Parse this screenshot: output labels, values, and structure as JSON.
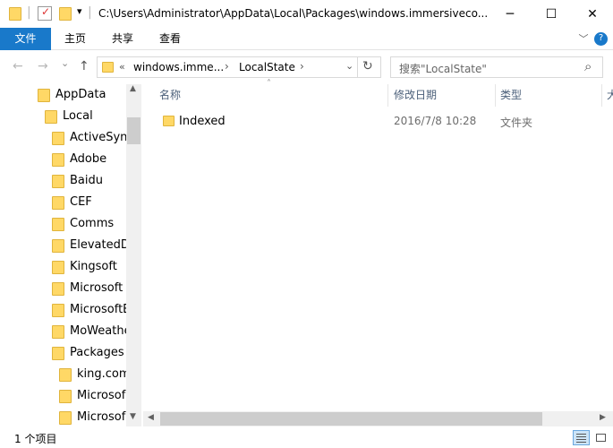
{
  "window": {
    "title": "C:\\Users\\Administrator\\AppData\\Local\\Packages\\windows.immersiveco...",
    "minimize": "─",
    "maximize": "☐",
    "close": "✕"
  },
  "ribbon": {
    "tabs": [
      "文件",
      "主页",
      "共享",
      "查看"
    ],
    "expand_icon": "﹀",
    "help_icon": "?"
  },
  "nav": {
    "back": "←",
    "forward": "→",
    "dropdown": "⌄",
    "up": "↑",
    "breadcrumb": [
      "«",
      "windows.imme...",
      "›",
      "LocalState",
      "›"
    ],
    "breadcrumb_dropdown": "⌄",
    "refresh": "↻"
  },
  "search": {
    "placeholder": "搜索\"LocalState\"",
    "icon": "⌕"
  },
  "tree": [
    {
      "label": "AppData",
      "level": 0
    },
    {
      "label": "Local",
      "level": 1
    },
    {
      "label": "ActiveSync",
      "level": 2
    },
    {
      "label": "Adobe",
      "level": 2
    },
    {
      "label": "Baidu",
      "level": 2
    },
    {
      "label": "CEF",
      "level": 2
    },
    {
      "label": "Comms",
      "level": 2
    },
    {
      "label": "ElevatedDi",
      "level": 2
    },
    {
      "label": "Kingsoft",
      "level": 2
    },
    {
      "label": "Microsoft",
      "level": 2
    },
    {
      "label": "MicrosoftE",
      "level": 2
    },
    {
      "label": "MoWeathe",
      "level": 2
    },
    {
      "label": "Packages",
      "level": 2
    },
    {
      "label": "king.com",
      "level": 3
    },
    {
      "label": "Microsof",
      "level": 3
    },
    {
      "label": "Microsof",
      "level": 3
    }
  ],
  "columns": {
    "name": "名称",
    "date": "修改日期",
    "type": "类型",
    "size": "大"
  },
  "files": [
    {
      "name": "Indexed",
      "date": "2016/7/8 10:28",
      "type": "文件夹"
    }
  ],
  "status": {
    "count": "1 个项目"
  },
  "colors": {
    "accent": "#1979ca",
    "folder": "#ffd866"
  }
}
